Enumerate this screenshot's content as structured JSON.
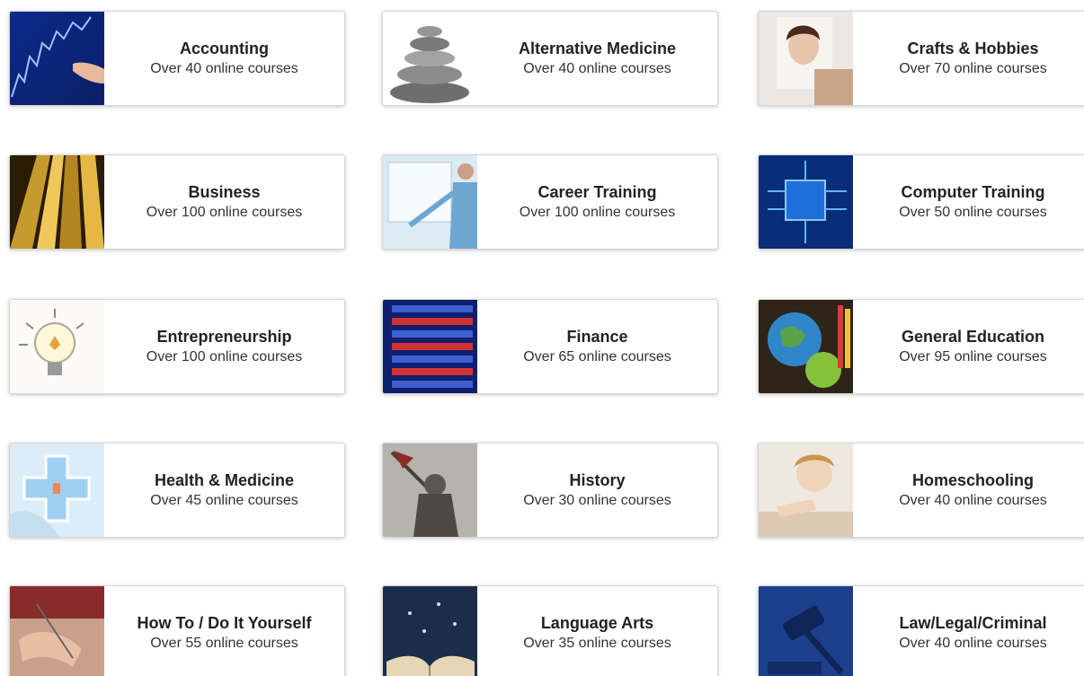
{
  "categories": [
    {
      "title": "Accounting",
      "subtitle": "Over 40 online courses",
      "image": "accounting-chart-image"
    },
    {
      "title": "Alternative Medicine",
      "subtitle": "Over 40 online courses",
      "image": "stacked-stones-image"
    },
    {
      "title": "Crafts & Hobbies",
      "subtitle": "Over 70 online courses",
      "image": "painting-portrait-image"
    },
    {
      "title": "Business",
      "subtitle": "Over 100 online courses",
      "image": "skyscraper-image"
    },
    {
      "title": "Career Training",
      "subtitle": "Over 100 online courses",
      "image": "presenter-whiteboard-image"
    },
    {
      "title": "Computer Training",
      "subtitle": "Over 50 online courses",
      "image": "circuit-chip-image"
    },
    {
      "title": "Entrepreneurship",
      "subtitle": "Over 100 online courses",
      "image": "light-bulb-image"
    },
    {
      "title": "Finance",
      "subtitle": "Over 65 online courses",
      "image": "stock-ticker-image"
    },
    {
      "title": "General Education",
      "subtitle": "Over 95 online courses",
      "image": "globe-apple-image"
    },
    {
      "title": "Health & Medicine",
      "subtitle": "Over 45 online courses",
      "image": "medical-cross-image"
    },
    {
      "title": "History",
      "subtitle": "Over 30 online courses",
      "image": "knight-statue-image"
    },
    {
      "title": "Homeschooling",
      "subtitle": "Over 40 online courses",
      "image": "child-writing-image"
    },
    {
      "title": "How To / Do It Yourself",
      "subtitle": "Over 55 online courses",
      "image": "sewing-hands-image"
    },
    {
      "title": "Language Arts",
      "subtitle": "Over 35 online courses",
      "image": "open-book-letters-image"
    },
    {
      "title": "Law/Legal/Criminal",
      "subtitle": "Over 40 online courses",
      "image": "gavel-image"
    }
  ]
}
